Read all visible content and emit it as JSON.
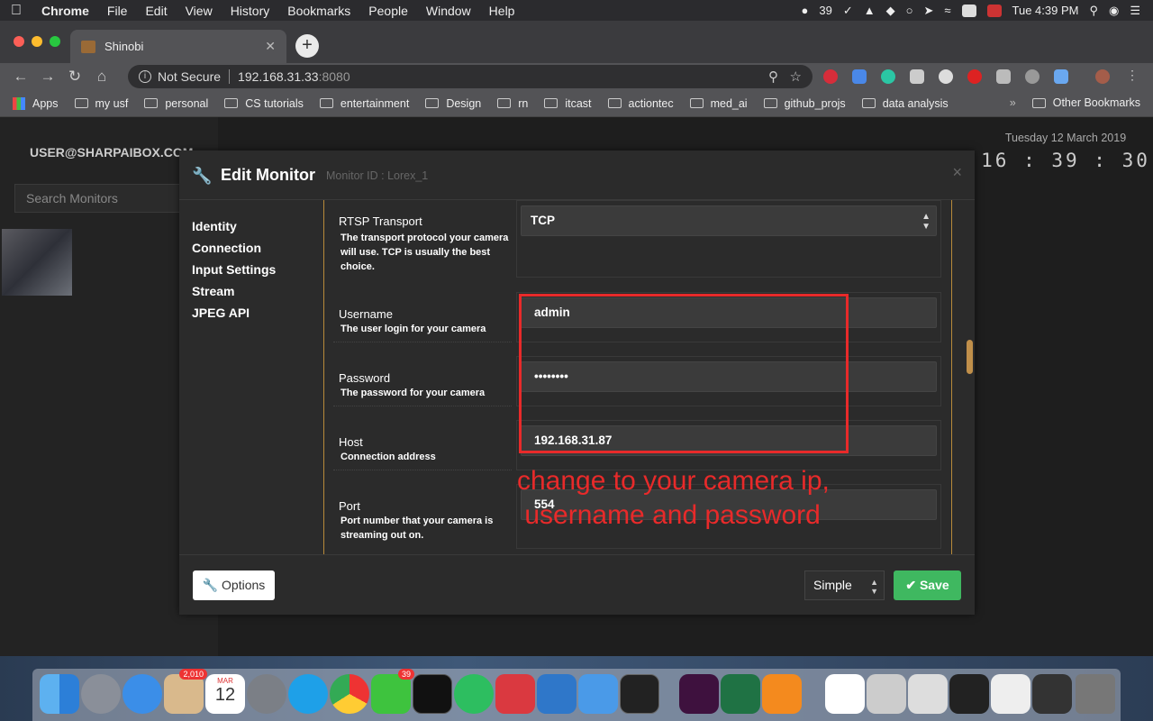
{
  "menubar": {
    "app": "Chrome",
    "items": [
      "File",
      "Edit",
      "View",
      "History",
      "Bookmarks",
      "People",
      "Window",
      "Help"
    ],
    "wechat_count": "39",
    "clock": "Tue 4:39 PM"
  },
  "browser": {
    "tab_title": "Shinobi",
    "security_label": "Not Secure",
    "url_host": "192.168.31.33",
    "url_port": ":8080",
    "bookmarks": [
      "Apps",
      "my usf",
      "personal",
      "CS tutorials",
      "entertainment",
      "Design",
      "rn",
      "itcast",
      "actiontec",
      "med_ai",
      "github_projs",
      "data analysis"
    ],
    "other_bookmarks": "Other Bookmarks",
    "more": "»"
  },
  "app": {
    "user": "USER@SHARPAIBOX.COM",
    "search_placeholder": "Search Monitors",
    "clock_date": "Tuesday 12 March 2019",
    "clock_time": "16 : 39 : 30"
  },
  "modal": {
    "title": "Edit Monitor",
    "subtitle": "Monitor ID : Lorex_1",
    "close": "×",
    "nav": [
      "Identity",
      "Connection",
      "Input Settings",
      "Stream",
      "JPEG API"
    ],
    "fields": [
      {
        "label": "RTSP Transport",
        "desc": "The transport protocol your camera will use. TCP is usually the best choice.",
        "value": "TCP",
        "type": "select"
      },
      {
        "label": "Username",
        "desc": "The user login for your camera",
        "value": "admin",
        "type": "text"
      },
      {
        "label": "Password",
        "desc": "The password for your camera",
        "value": "••••••••",
        "type": "password"
      },
      {
        "label": "Host",
        "desc": "Connection address",
        "value": "192.168.31.87",
        "type": "text"
      },
      {
        "label": "Port",
        "desc": "Port number that your camera is streaming out on.",
        "value": "554",
        "type": "text"
      }
    ],
    "options_label": "Options",
    "mode_value": "Simple",
    "save_label": "Save"
  },
  "annotation": {
    "line1": "change to your camera ip,",
    "line2": " username and password",
    "color": "#e82a2a"
  },
  "dock": {
    "mail_badge": "2,010",
    "wechat_badge": "39",
    "calendar_month": "MAR",
    "calendar_day": "12"
  }
}
